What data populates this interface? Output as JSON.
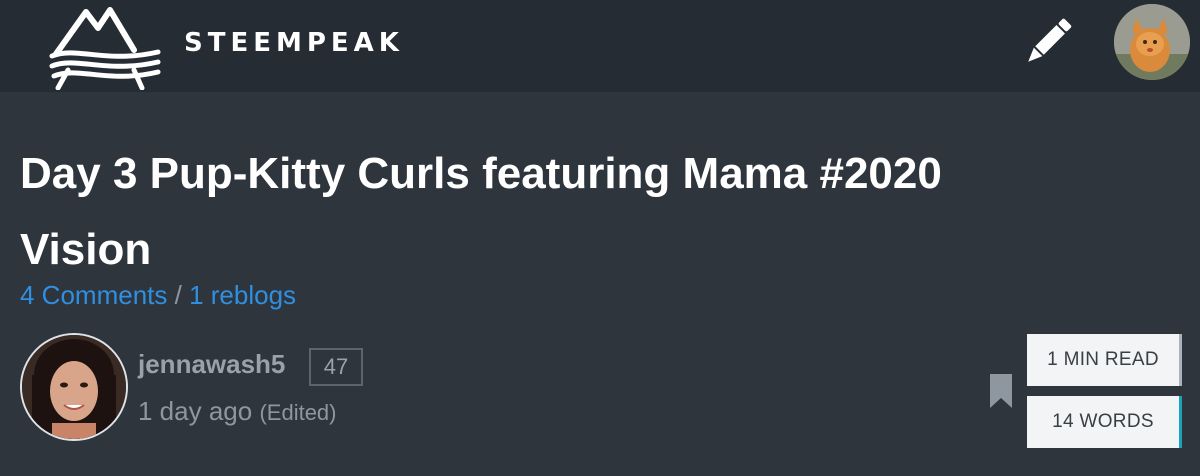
{
  "header": {
    "brand": "STEEMPEAK",
    "logo_icon": "steempeak-mountain-logo",
    "write_icon": "pencil-icon",
    "user_avatar": "kitten-avatar"
  },
  "post": {
    "title": "Day 3 Pup-Kitty Curls featuring Mama #2020 Vision",
    "comments_link": "4 Comments",
    "separator": "/",
    "reblogs_link": "1 reblogs",
    "author": {
      "name": "jennawash5",
      "reputation": "47",
      "timestamp": "1 day ago",
      "edited": "(Edited)"
    },
    "bookmark_icon": "bookmark-icon",
    "stats": {
      "read_time": "1 MIN READ",
      "word_count": "14 WORDS"
    }
  },
  "colors": {
    "header_bg": "#262c33",
    "page_bg": "#2f353d",
    "link": "#2f8fe0",
    "words_accent": "#1aa3bd"
  }
}
